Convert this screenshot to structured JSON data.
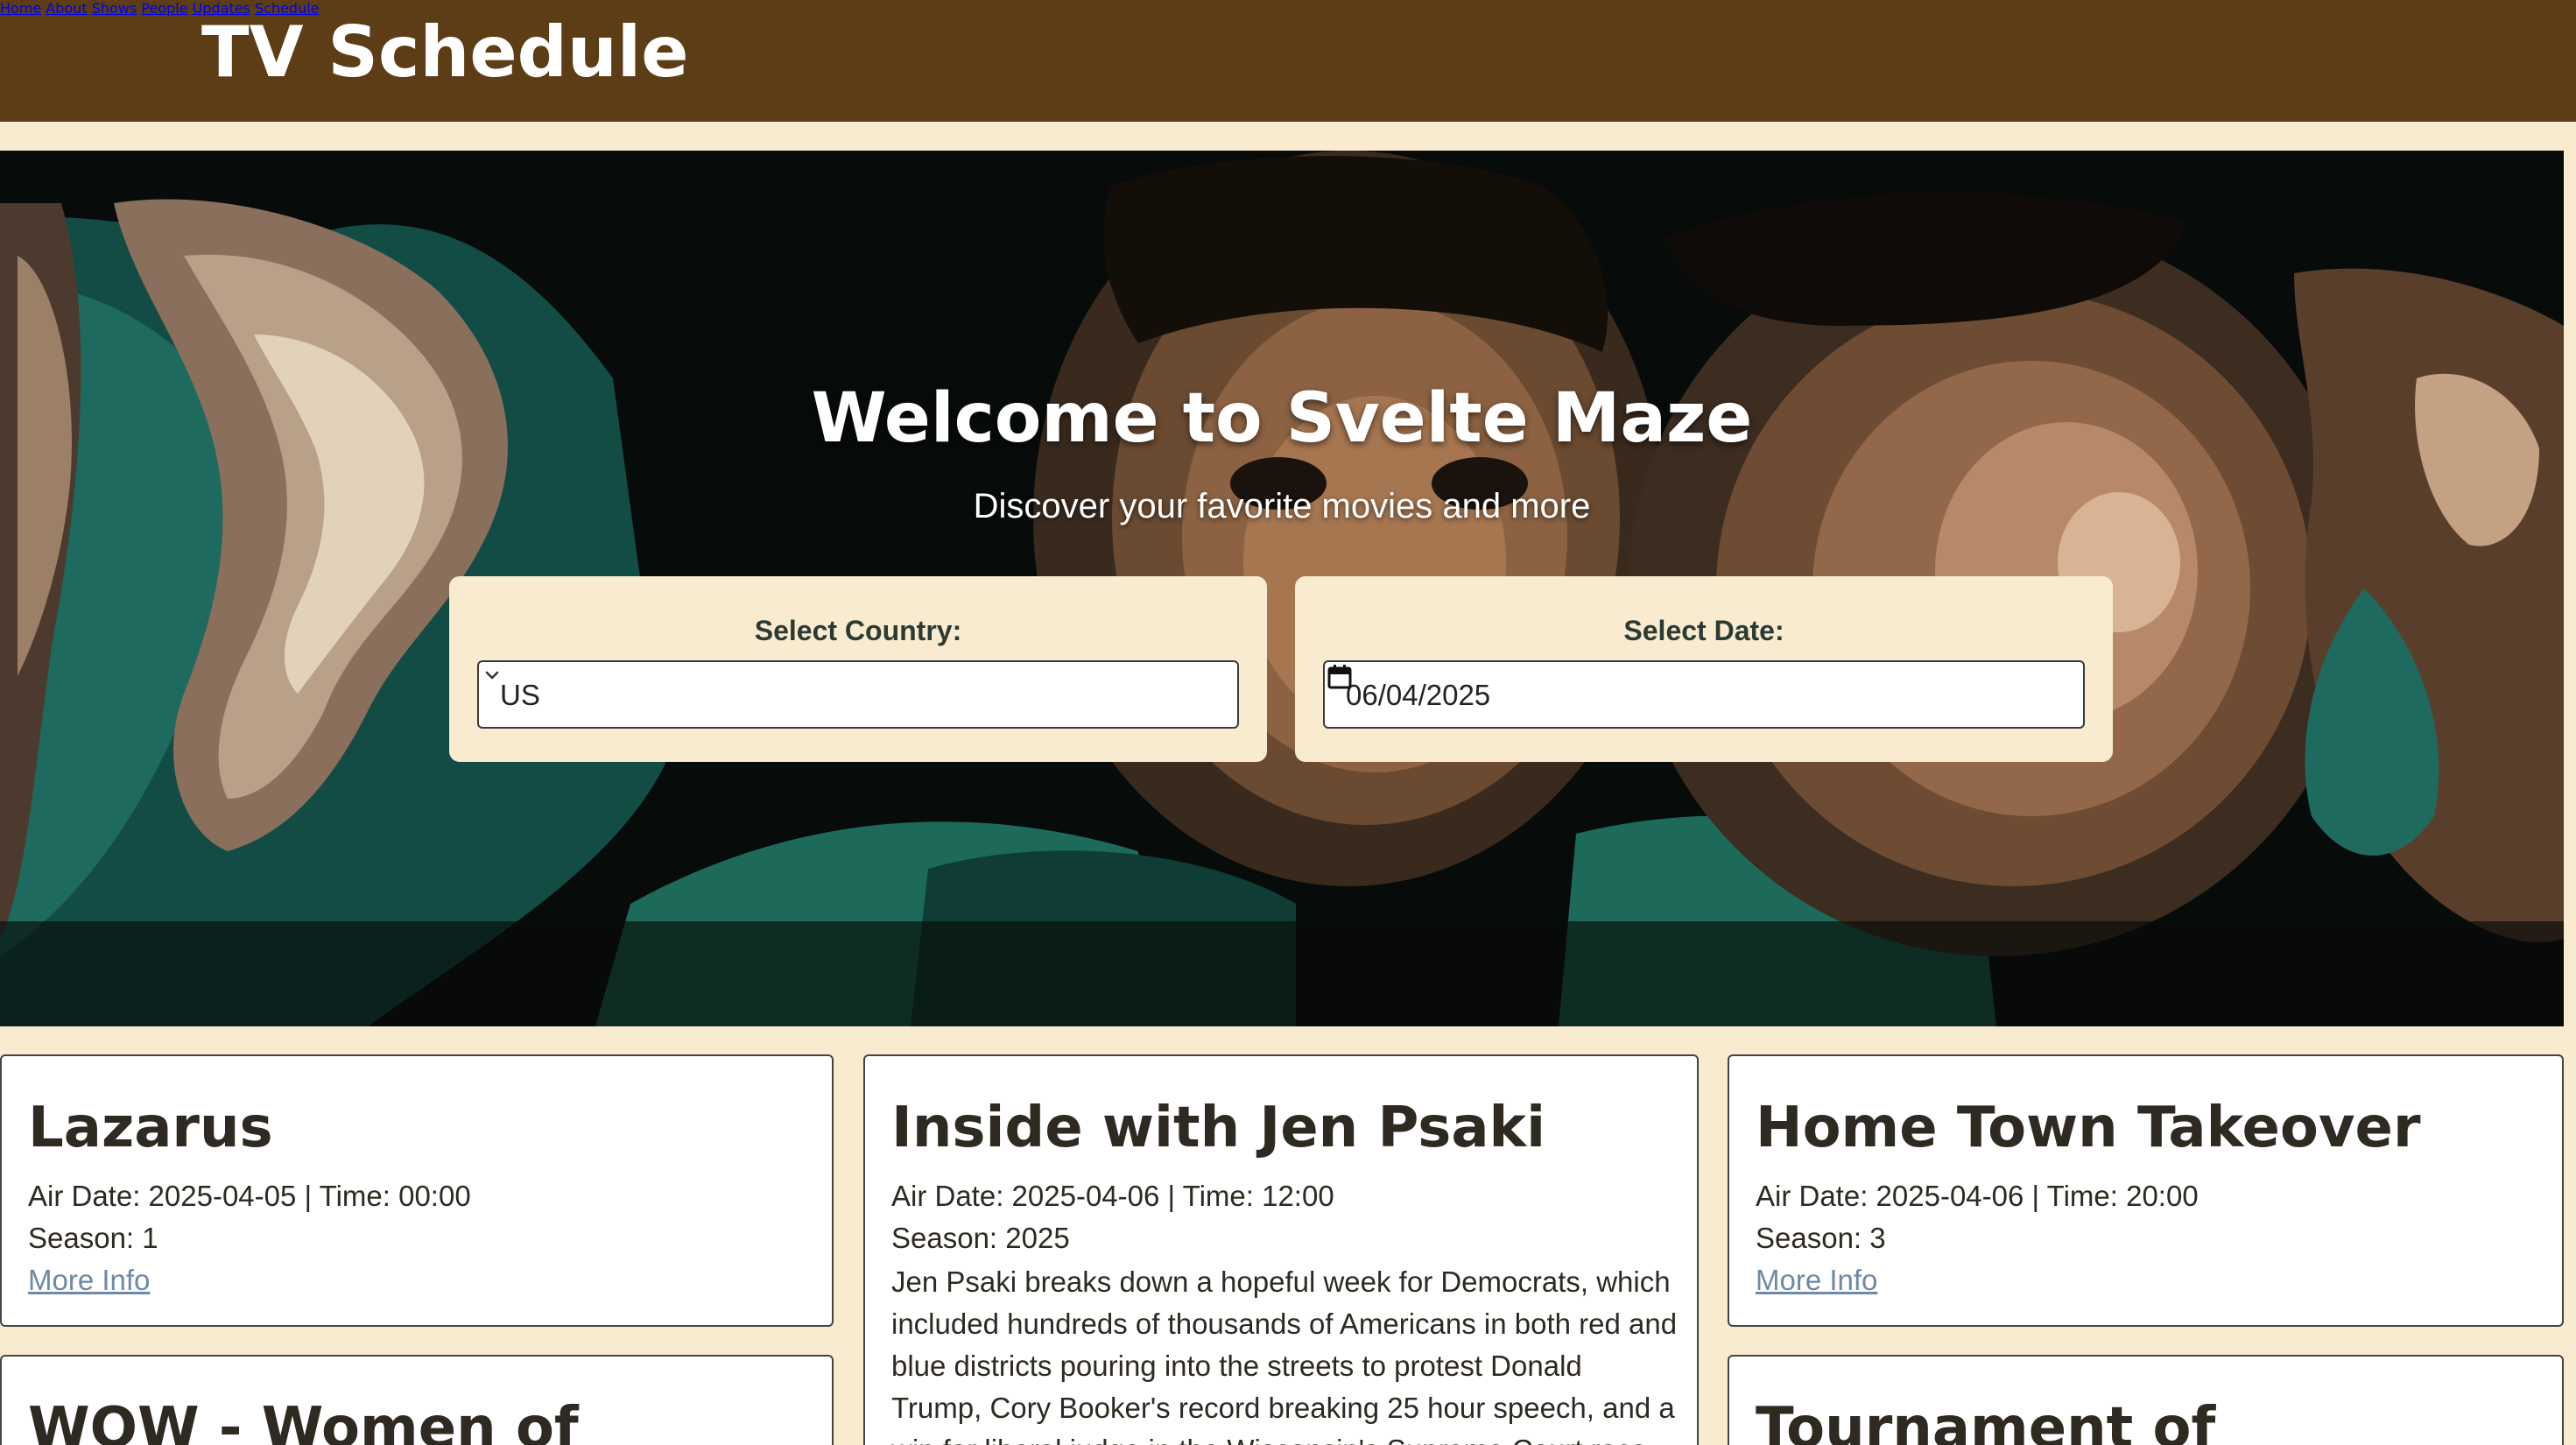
{
  "header": {
    "brand": "TV Schedule",
    "nav": [
      "Home",
      "About",
      "Shows",
      "People",
      "Updates",
      "Schedule"
    ]
  },
  "hero": {
    "title": "Welcome to Svelte Maze",
    "subtitle": "Discover your favorite movies and more",
    "country": {
      "label": "Select Country:",
      "value": "US"
    },
    "date": {
      "label": "Select Date:",
      "value": "06/04/2025"
    }
  },
  "cards": [
    {
      "title": "Lazarus",
      "airline": "Air Date: 2025-04-05 | Time: 00:00",
      "season": "Season: 1",
      "link": "More Info"
    },
    {
      "title": "Inside with Jen Psaki",
      "airline": "Air Date: 2025-04-06 | Time: 12:00",
      "season": "Season: 2025",
      "summary": "Jen Psaki breaks down a hopeful week for Democrats, which included hundreds of thousands of Americans in both red and blue districts pouring into the streets to protest Donald Trump, Cory Booker's record breaking 25 hour speech, and a win for liberal judge in the Wisconsin's Supreme Court race against the"
    },
    {
      "title": "Home Town Takeover",
      "airline": "Air Date: 2025-04-06 | Time: 20:00",
      "season": "Season: 3",
      "link": "More Info"
    },
    {
      "title": "WOW - Women of"
    },
    {
      "title": "Tournament of"
    }
  ],
  "colors": {
    "header_bg": "#5c3d16",
    "page_bg": "#f8ebcf",
    "link": "#6d8aa6",
    "picker_label": "#2b3b33"
  },
  "icons": [
    "chevron-down-icon",
    "calendar-icon"
  ]
}
